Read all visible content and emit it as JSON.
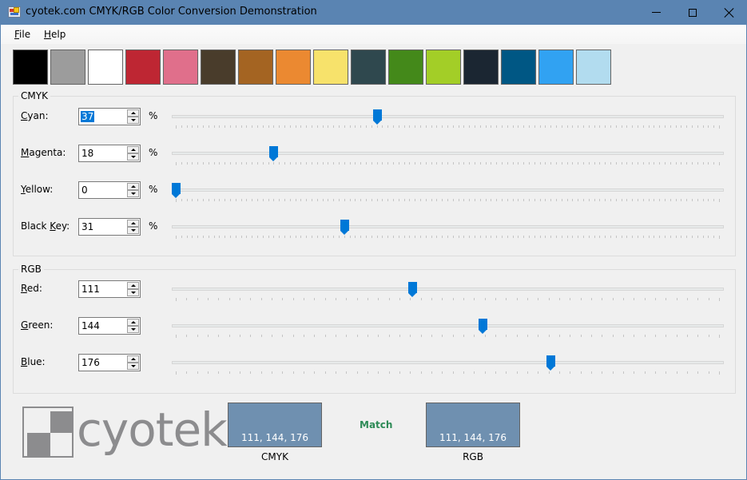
{
  "window": {
    "title": "cyotek.com CMYK/RGB Color Conversion Demonstration",
    "controls": {
      "minimize": "minimize",
      "maximize": "maximize",
      "close": "close"
    }
  },
  "menu": {
    "items": [
      {
        "label": "File",
        "mnemonic": "F",
        "rest": "ile"
      },
      {
        "label": "Help",
        "mnemonic": "H",
        "rest": "elp"
      }
    ]
  },
  "palette": {
    "swatches": [
      "#000000",
      "#9c9c9c",
      "#ffffff",
      "#be2633",
      "#e06f8b",
      "#493c2b",
      "#a46422",
      "#eb8931",
      "#f7e26b",
      "#2f484e",
      "#44891a",
      "#a3ce27",
      "#1b2632",
      "#005784",
      "#31a2f2",
      "#b2dcef"
    ]
  },
  "cmyk": {
    "group_label": "CMYK",
    "unit": "%",
    "rows": [
      {
        "key": "cyan",
        "mnemonic": "C",
        "rest": "yan:",
        "pre": "",
        "value": "37",
        "fraction": 0.37,
        "max": 100,
        "selected": true
      },
      {
        "key": "magenta",
        "mnemonic": "M",
        "rest": "agenta:",
        "pre": "",
        "value": "18",
        "fraction": 0.18,
        "max": 100,
        "selected": false
      },
      {
        "key": "yellow",
        "mnemonic": "Y",
        "rest": "ellow:",
        "pre": "",
        "value": "0",
        "fraction": 0.0,
        "max": 100,
        "selected": false
      },
      {
        "key": "black-key",
        "mnemonic": "K",
        "rest": "ey:",
        "pre": "Black ",
        "value": "31",
        "fraction": 0.31,
        "max": 100,
        "selected": false
      }
    ]
  },
  "rgb": {
    "group_label": "RGB",
    "rows": [
      {
        "key": "red",
        "mnemonic": "R",
        "rest": "ed:",
        "pre": "",
        "value": "111",
        "fraction": 0.4353,
        "max": 255
      },
      {
        "key": "green",
        "mnemonic": "G",
        "rest": "reen:",
        "pre": "",
        "value": "144",
        "fraction": 0.5647,
        "max": 255
      },
      {
        "key": "blue",
        "mnemonic": "B",
        "rest": "lue:",
        "pre": "",
        "value": "176",
        "fraction": 0.6902,
        "max": 255
      }
    ]
  },
  "logo": {
    "text": "cyotek"
  },
  "preview": {
    "cmyk": {
      "label": "CMYK",
      "text": "111, 144, 176",
      "color": "#6f90b0"
    },
    "rgb": {
      "label": "RGB",
      "text": "111, 144, 176",
      "color": "#6f90b0"
    },
    "match_text": "Match",
    "match_color": "#2e8b57"
  }
}
